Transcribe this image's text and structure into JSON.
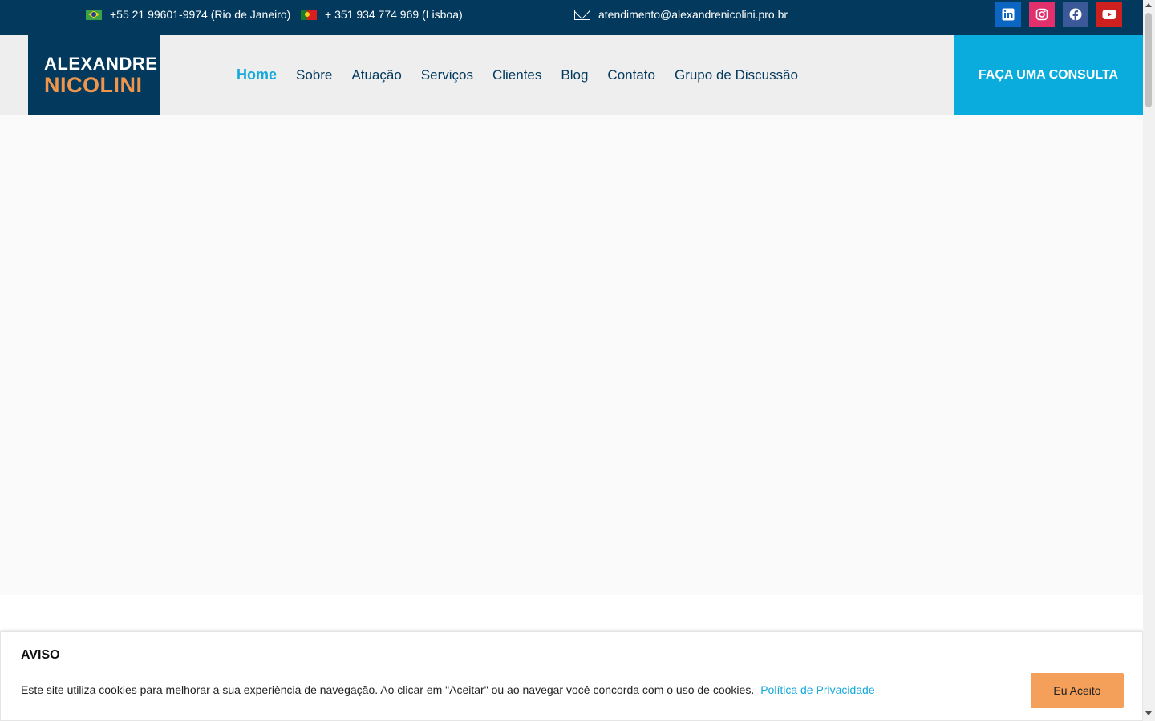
{
  "topbar": {
    "phone_br": "+55 21 99601-9974 (Rio de Janeiro)",
    "phone_pt": "+ 351 934 774 969 (Lisboa)",
    "email": "atendimento@alexandrenicolini.pro.br",
    "social": [
      {
        "icon": "linkedin-icon",
        "color": "#0a66c2"
      },
      {
        "icon": "instagram-icon",
        "color": "#e1306c"
      },
      {
        "icon": "facebook-icon",
        "color": "#3b5998"
      },
      {
        "icon": "youtube-icon",
        "color": "#cd201f"
      }
    ]
  },
  "logo": {
    "line1": "ALEXANDRE",
    "line2": "NICOLINI"
  },
  "nav": {
    "items": [
      "Home",
      "Sobre",
      "Atuação",
      "Serviços",
      "Clientes",
      "Blog",
      "Contato",
      "Grupo de Discussão"
    ],
    "active": "Home"
  },
  "cta_label": "FAÇA UMA CONSULTA",
  "cookie": {
    "title": "AVISO",
    "text": "Este site utiliza cookies para melhorar a sua experiência de navegação. Ao clicar em \"Aceitar\" ou ao navegar você concorda com o uso de cookies.",
    "link": "Política de Privacidade",
    "button": "Eu Aceito"
  },
  "colors": {
    "navy": "#02395d",
    "accent": "#09acdd",
    "orange": "#f0954c"
  }
}
